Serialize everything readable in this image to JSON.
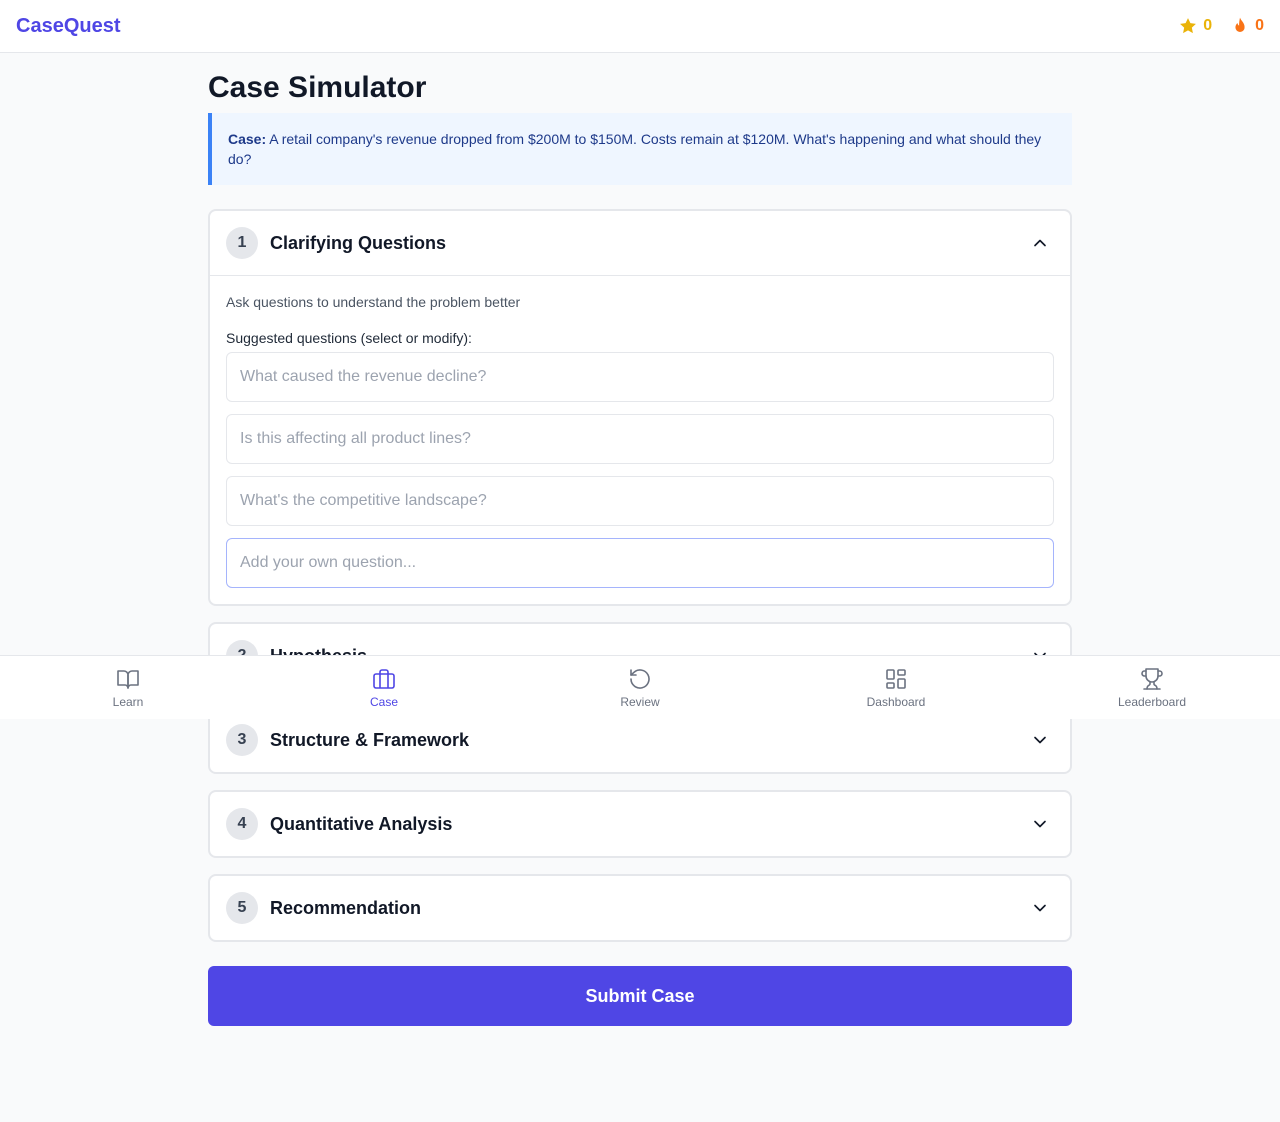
{
  "app": {
    "brand": "CaseQuest"
  },
  "stats": {
    "stars": "0",
    "streak": "0"
  },
  "page": {
    "title": "Case Simulator",
    "case_label": "Case:",
    "case_text": "A retail company's revenue dropped from $200M to $150M. Costs remain at $120M. What's happening and what should they do?"
  },
  "steps": [
    {
      "num": "1",
      "title": "Clarifying Questions",
      "expanded": true
    },
    {
      "num": "2",
      "title": "Hypothesis",
      "expanded": false
    },
    {
      "num": "3",
      "title": "Structure & Framework",
      "expanded": false
    },
    {
      "num": "4",
      "title": "Quantitative Analysis",
      "expanded": false
    },
    {
      "num": "5",
      "title": "Recommendation",
      "expanded": false
    }
  ],
  "clarifying": {
    "hint": "Ask questions to understand the problem better",
    "suggested_label": "Suggested questions (select or modify):",
    "questions": [
      "What caused the revenue decline?",
      "Is this affecting all product lines?",
      "What's the competitive landscape?"
    ],
    "own_placeholder": "Add your own question..."
  },
  "submit_label": "Submit Case",
  "nav": [
    {
      "label": "Learn",
      "icon": "book-open-icon",
      "active": false
    },
    {
      "label": "Case",
      "icon": "briefcase-icon",
      "active": true
    },
    {
      "label": "Review",
      "icon": "rotate-ccw-icon",
      "active": false
    },
    {
      "label": "Dashboard",
      "icon": "layout-grid-icon",
      "active": false
    },
    {
      "label": "Leaderboard",
      "icon": "trophy-icon",
      "active": false
    }
  ],
  "colors": {
    "accent": "#4f46e5",
    "case_border": "#3b82f6",
    "star": "#eab308",
    "flame": "#f97316"
  }
}
